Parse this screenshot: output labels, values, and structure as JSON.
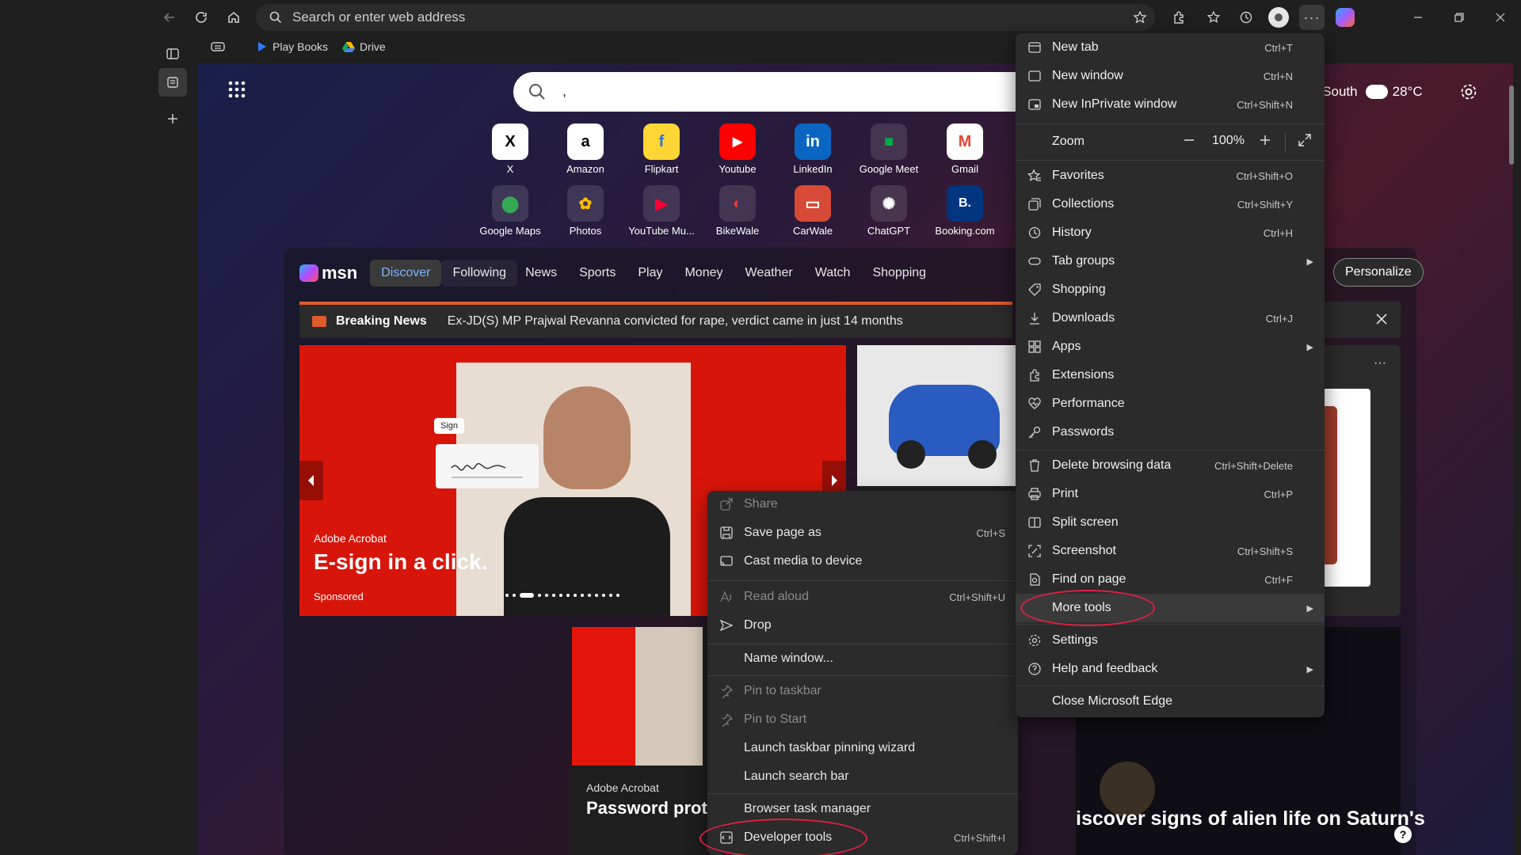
{
  "address_bar": {
    "placeholder": "Search or enter web address"
  },
  "bookmarks": [
    {
      "label": "Play Books"
    },
    {
      "label": "Drive"
    }
  ],
  "new_tab_page": {
    "search_placeholder": ",",
    "weather": {
      "location": "u South",
      "temp": "28°C"
    },
    "quick_links": [
      {
        "label": "X",
        "icon": "X"
      },
      {
        "label": "Amazon",
        "icon": "a"
      },
      {
        "label": "Flipkart",
        "icon": "f"
      },
      {
        "label": "Youtube",
        "icon": "▶"
      },
      {
        "label": "LinkedIn",
        "icon": "in"
      },
      {
        "label": "Google Meet",
        "icon": "■"
      },
      {
        "label": "Gmail",
        "icon": "M"
      },
      {
        "label": "Google Maps",
        "icon": "⬤"
      },
      {
        "label": "Photos",
        "icon": "✿"
      },
      {
        "label": "YouTube Mu...",
        "icon": "▶"
      },
      {
        "label": "BikeWale",
        "icon": "◐"
      },
      {
        "label": "CarWale",
        "icon": "▭"
      },
      {
        "label": "ChatGPT",
        "icon": "✺"
      },
      {
        "label": "Booking.com",
        "icon": "B."
      }
    ],
    "msn": {
      "logo": "msn",
      "nav": [
        "Discover",
        "Following",
        "News",
        "Sports",
        "Play",
        "Money",
        "Weather",
        "Watch",
        "Shopping"
      ],
      "personalize": "Personalize",
      "breaking_label": "Breaking News",
      "breaking_text": "Ex-JD(S) MP Prajwal Revanna convicted for rape, verdict came in just 14 months",
      "hero": {
        "brand": "Adobe Acrobat",
        "title": "E-sign in a click.",
        "tag": "Sponsored",
        "sign_chip": "Sign"
      },
      "card2": {
        "brand": "Adobe Acrobat",
        "title": "Password prot"
      },
      "card3": {
        "title": "iscover signs of alien life on Saturn's"
      }
    }
  },
  "context_menu": {
    "items": [
      {
        "label": "Share",
        "shortcut": "",
        "icon": "share-icon",
        "disabled": true
      },
      {
        "label": "Save page as",
        "shortcut": "Ctrl+S",
        "icon": "save-icon",
        "disabled": false
      },
      {
        "label": "Cast media to device",
        "shortcut": "",
        "icon": "cast-icon",
        "disabled": false
      },
      {
        "label": "Read aloud",
        "shortcut": "Ctrl+Shift+U",
        "icon": "read-aloud-icon",
        "disabled": true
      },
      {
        "label": "Drop",
        "shortcut": "",
        "icon": "drop-icon",
        "disabled": false
      },
      {
        "label": "Name window...",
        "shortcut": "",
        "icon": "",
        "disabled": false
      },
      {
        "label": "Pin to taskbar",
        "shortcut": "",
        "icon": "pin-icon",
        "disabled": true
      },
      {
        "label": "Pin to Start",
        "shortcut": "",
        "icon": "pin-icon",
        "disabled": true
      },
      {
        "label": "Launch taskbar pinning wizard",
        "shortcut": "",
        "icon": "",
        "disabled": false
      },
      {
        "label": "Launch search bar",
        "shortcut": "",
        "icon": "",
        "disabled": false
      },
      {
        "label": "Browser task manager",
        "shortcut": "",
        "icon": "",
        "disabled": false
      },
      {
        "label": "Developer tools",
        "shortcut": "Ctrl+Shift+I",
        "icon": "devtools-icon",
        "disabled": false
      }
    ]
  },
  "main_menu": {
    "items": [
      {
        "label": "New tab",
        "shortcut": "Ctrl+T",
        "icon": "new-tab-icon",
        "submenu": false
      },
      {
        "label": "New window",
        "shortcut": "Ctrl+N",
        "icon": "new-window-icon",
        "submenu": false
      },
      {
        "label": "New InPrivate window",
        "shortcut": "Ctrl+Shift+N",
        "icon": "inprivate-icon",
        "submenu": false
      },
      {
        "label": "Favorites",
        "shortcut": "Ctrl+Shift+O",
        "icon": "favorites-icon",
        "submenu": false
      },
      {
        "label": "Collections",
        "shortcut": "Ctrl+Shift+Y",
        "icon": "collections-icon",
        "submenu": false
      },
      {
        "label": "History",
        "shortcut": "Ctrl+H",
        "icon": "history-icon",
        "submenu": false
      },
      {
        "label": "Tab groups",
        "shortcut": "",
        "icon": "tab-groups-icon",
        "submenu": true
      },
      {
        "label": "Shopping",
        "shortcut": "",
        "icon": "shopping-icon",
        "submenu": false
      },
      {
        "label": "Downloads",
        "shortcut": "Ctrl+J",
        "icon": "downloads-icon",
        "submenu": false
      },
      {
        "label": "Apps",
        "shortcut": "",
        "icon": "apps-icon",
        "submenu": true
      },
      {
        "label": "Extensions",
        "shortcut": "",
        "icon": "extensions-icon",
        "submenu": false
      },
      {
        "label": "Performance",
        "shortcut": "",
        "icon": "performance-icon",
        "submenu": false
      },
      {
        "label": "Passwords",
        "shortcut": "",
        "icon": "passwords-icon",
        "submenu": false
      },
      {
        "label": "Delete browsing data",
        "shortcut": "Ctrl+Shift+Delete",
        "icon": "delete-icon",
        "submenu": false
      },
      {
        "label": "Print",
        "shortcut": "Ctrl+P",
        "icon": "print-icon",
        "submenu": false
      },
      {
        "label": "Split screen",
        "shortcut": "",
        "icon": "split-screen-icon",
        "submenu": false
      },
      {
        "label": "Screenshot",
        "shortcut": "Ctrl+Shift+S",
        "icon": "screenshot-icon",
        "submenu": false
      },
      {
        "label": "Find on page",
        "shortcut": "Ctrl+F",
        "icon": "find-icon",
        "submenu": false
      },
      {
        "label": "More tools",
        "shortcut": "",
        "icon": "",
        "submenu": true
      },
      {
        "label": "Settings",
        "shortcut": "",
        "icon": "settings-icon",
        "submenu": false
      },
      {
        "label": "Help and feedback",
        "shortcut": "",
        "icon": "help-icon",
        "submenu": true
      },
      {
        "label": "Close Microsoft Edge",
        "shortcut": "",
        "icon": "",
        "submenu": false
      }
    ],
    "zoom": {
      "label": "Zoom",
      "value": "100%"
    }
  },
  "colors": {
    "accent_red": "#e02040",
    "menu_bg": "#2b2b2b",
    "page_bg": "#1f1f1f"
  }
}
